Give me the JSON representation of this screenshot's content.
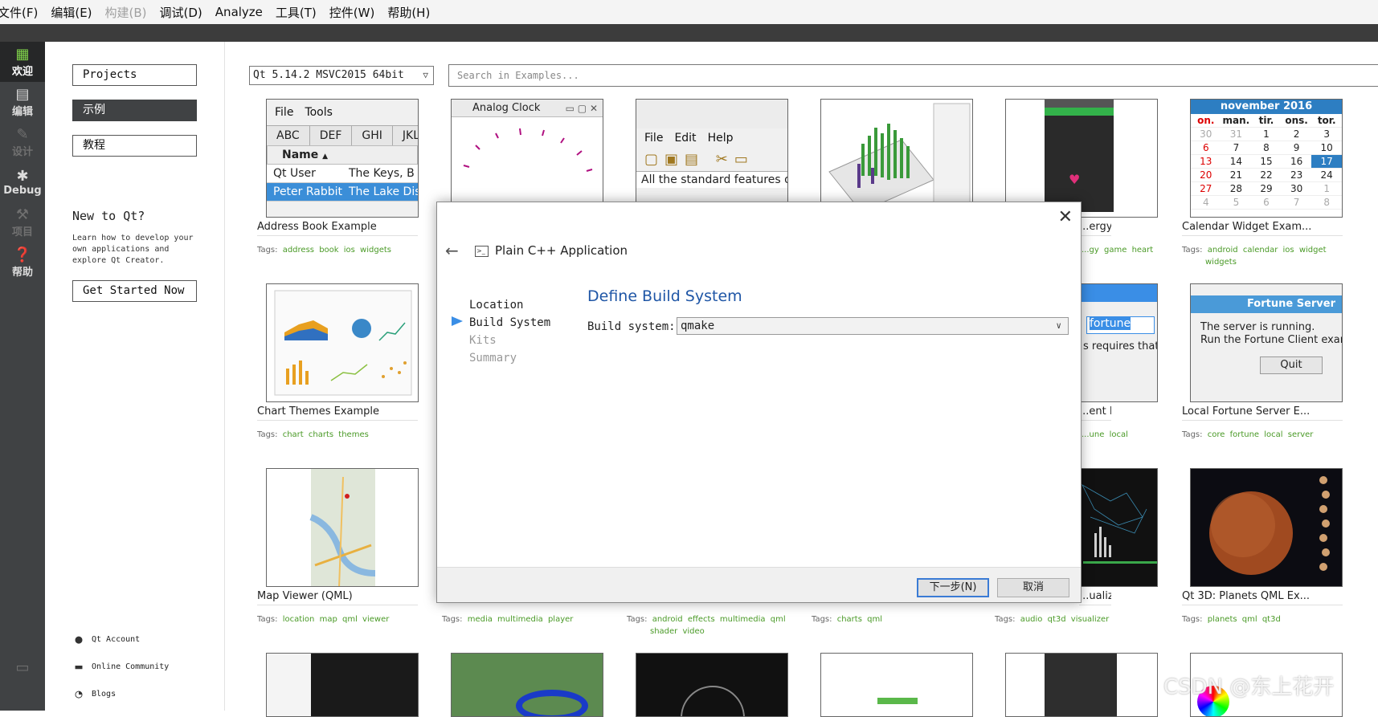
{
  "menubar": {
    "items": [
      {
        "label": "文件(F)",
        "enabled": true
      },
      {
        "label": "编辑(E)",
        "enabled": true
      },
      {
        "label": "构建(B)",
        "enabled": false
      },
      {
        "label": "调试(D)",
        "enabled": true
      },
      {
        "label": "Analyze",
        "enabled": true
      },
      {
        "label": "工具(T)",
        "enabled": true
      },
      {
        "label": "控件(W)",
        "enabled": true
      },
      {
        "label": "帮助(H)",
        "enabled": true
      }
    ]
  },
  "modebar": {
    "welcome": "欢迎",
    "edit": "编辑",
    "design": "设计",
    "debug": "Debug",
    "projects": "项目",
    "help": "帮助"
  },
  "welcome": {
    "projects_btn": "Projects",
    "examples_btn": "示例",
    "tutorials_btn": "教程",
    "new_title": "New to Qt?",
    "new_text": "Learn how to develop your own applications and explore Qt Creator.",
    "get_started": "Get Started Now",
    "links": {
      "account": "Qt Account",
      "community": "Online Community",
      "blogs": "Blogs"
    }
  },
  "examples": {
    "kit": "Qt 5.14.2 MSVC2015 64bit",
    "search_placeholder": "Search in Examples...",
    "tiles": {
      "address_book": {
        "title": "Address Book Example",
        "tags": [
          "address",
          "book",
          "ios",
          "widgets"
        ]
      },
      "energy": {
        "title": "...ergy ...",
        "tags": [
          "...gy",
          "game",
          "heart"
        ]
      },
      "calendar": {
        "title": "Calendar Widget Exam...",
        "tags": [
          "android",
          "calendar",
          "ios",
          "widget",
          "widgets"
        ]
      },
      "chart_themes": {
        "title": "Chart Themes Example",
        "tags": [
          "chart",
          "charts",
          "themes"
        ]
      },
      "fortune_client": {
        "title": "...ent Ex...",
        "tags": [
          "...une",
          "local"
        ]
      },
      "fortune_server": {
        "title": "Local Fortune Server E...",
        "tags": [
          "core",
          "fortune",
          "local",
          "server"
        ]
      },
      "map_viewer": {
        "title": "Map Viewer (QML)",
        "tags": [
          "location",
          "map",
          "qml",
          "viewer"
        ]
      },
      "media": {
        "tags": [
          "media",
          "multimedia",
          "player"
        ]
      },
      "effects": {
        "tags": [
          "android",
          "effects",
          "multimedia",
          "qml",
          "shader",
          "video"
        ]
      },
      "charts_qml": {
        "tags": [
          "charts",
          "qml"
        ]
      },
      "visualizer": {
        "title": "...ualizer...",
        "tags": [
          "audio",
          "qt3d",
          "visualizer"
        ]
      },
      "planets": {
        "title": "Qt 3D: Planets QML Ex...",
        "tags": [
          "planets",
          "qml",
          "qt3d"
        ]
      }
    },
    "tags_prefix": "Tags:"
  },
  "thumbs": {
    "ab_menu": [
      "File",
      "Tools"
    ],
    "ab_tabs": [
      "ABC",
      "DEF",
      "GHI",
      "JKL"
    ],
    "ab_header": "Name",
    "ab_rows": [
      [
        "Qt User",
        "The Keys, B"
      ],
      [
        "Peter Rabbit",
        "The Lake Dis"
      ]
    ],
    "clock_title": "Analog Clock",
    "mw_menu": [
      "File",
      "Edit",
      "Help"
    ],
    "mw_text": "All the standard features of",
    "cal_header": "november  2016",
    "cal_weekdays": [
      "on.",
      "man.",
      "tir.",
      "ons.",
      "tor."
    ],
    "cal_rows": [
      [
        "30",
        "31",
        "1",
        "2",
        "3"
      ],
      [
        "6",
        "7",
        "8",
        "9",
        "10"
      ],
      [
        "13",
        "14",
        "15",
        "16",
        "17"
      ],
      [
        "20",
        "21",
        "22",
        "23",
        "24"
      ],
      [
        "27",
        "28",
        "29",
        "30",
        "1"
      ],
      [
        "4",
        "5",
        "6",
        "7",
        "8"
      ]
    ],
    "fc_field": "fortune",
    "fc_text": "s requires that y",
    "fs_title": "Fortune Server",
    "fs_line1": "The server is running.",
    "fs_line2": "Run the Fortune Client exam",
    "fs_quit": "Quit"
  },
  "dialog": {
    "title": "Plain C++ Application",
    "steps": [
      "Location",
      "Build System",
      "Kits",
      "Summary"
    ],
    "current_step": "Build System",
    "heading": "Define Build System",
    "build_system_label": "Build system:",
    "build_system_value": "qmake",
    "next_btn": "下一步(N)",
    "cancel_btn": "取消"
  },
  "watermark": "CSDN @东上花开",
  "colors": {
    "accent": "#1f56a6",
    "tag_green": "#4a9a27",
    "modebar_bg": "#404244",
    "selection_blue": "#3a8ee6"
  }
}
